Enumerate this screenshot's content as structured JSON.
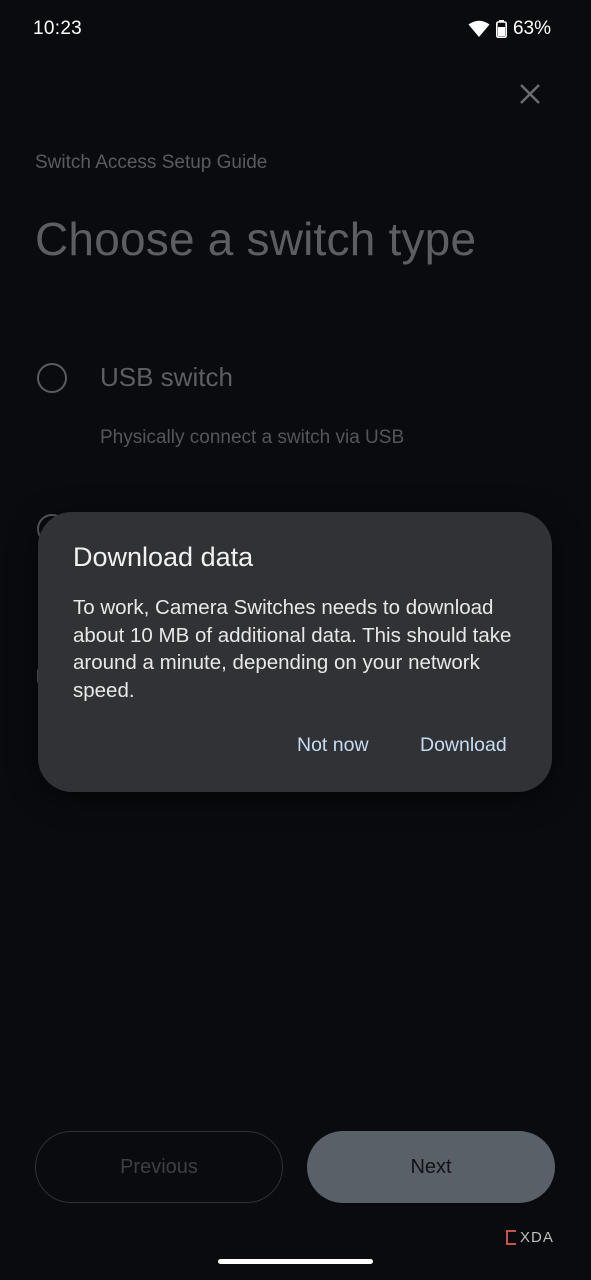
{
  "status_bar": {
    "time": "10:23",
    "battery": "63%",
    "icons": [
      "wifi-icon",
      "battery-icon"
    ]
  },
  "header": {
    "close_icon": "close-icon",
    "subtitle": "Switch Access Setup Guide",
    "title": "Choose a switch type"
  },
  "options": [
    {
      "label": "USB switch",
      "description": "Physically connect a switch via USB",
      "selected": false
    }
  ],
  "dialog": {
    "title": "Download data",
    "body": "To work, Camera Switches needs to download about 10 MB of additional data. This should take around a minute, depending on your network speed.",
    "negative_label": "Not now",
    "positive_label": "Download"
  },
  "footer": {
    "previous_label": "Previous",
    "next_label": "Next"
  },
  "watermark": "XDA",
  "colors": {
    "background": "#0a0b0f",
    "dialog": "#313235",
    "accent_text": "#c6dcf3",
    "next_button": "#5a6067"
  }
}
